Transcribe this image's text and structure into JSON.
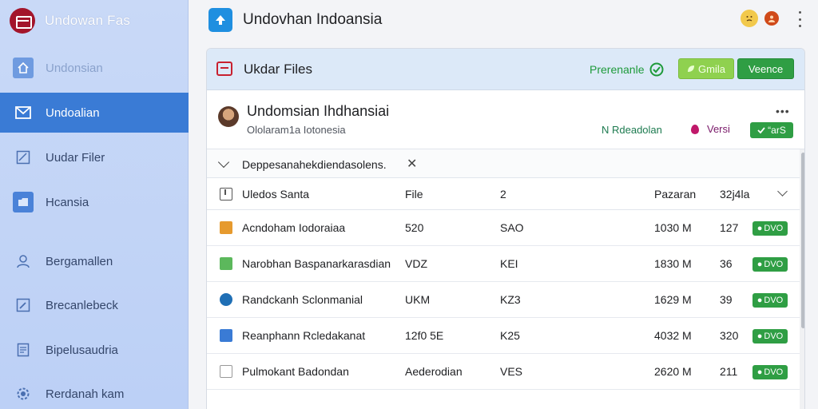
{
  "colors": {
    "sidebar_bg": "#c9d9f7",
    "active_nav": "#3a7bd5",
    "brand_red": "#a3152b",
    "accent_green": "#2f9e44",
    "lime": "#8fd14f",
    "header_blue": "#dce9f8"
  },
  "sidebar": {
    "brand_title": "Undowan Fas",
    "items": [
      {
        "label": "Undonsian",
        "icon": "home-icon"
      },
      {
        "label": "Undoalian",
        "icon": "mail-icon"
      },
      {
        "label": "Uudar Filer",
        "icon": "file-icon"
      },
      {
        "label": "Hcansia",
        "icon": "folder-icon"
      },
      {
        "label": "Bergamallen",
        "icon": "user-icon"
      },
      {
        "label": "Brecanlebeck",
        "icon": "edit-icon"
      },
      {
        "label": "Bipelusaudria",
        "icon": "document-icon"
      },
      {
        "label": "Rerdanah kam",
        "icon": "settings-icon"
      }
    ]
  },
  "topbar": {
    "title": "Undovhan Indoansia",
    "logo_icon": "upload-icon",
    "emoji_icon": "emoji-icon",
    "account_icon": "account-icon",
    "menu_icon": "more-vertical-icon"
  },
  "panel": {
    "header": {
      "icon": "folder-red-icon",
      "title": "Ukdar Files",
      "link_label": "Prerenanle",
      "lime_button": "Gmila",
      "green_button": "Veence"
    },
    "profile": {
      "name": "Undomsian Ihdhansiai",
      "subtitle": "Ololaram1a Iotonesia",
      "more": "•••",
      "tag1": "N Rdeadolan",
      "tag2": "Versi",
      "badge": "“arS"
    },
    "filter": {
      "text": "Deppesanahekdiendasolens.",
      "clear": "✕"
    },
    "columns": [
      "Uledos Santa",
      "File",
      "2",
      "Pazaran",
      "32j4la"
    ],
    "rows": [
      {
        "name": "Acndoham Iodoraiaa",
        "file": "520",
        "col3": "SAO",
        "size": "1030 M",
        "count": "127",
        "badge": "DVO",
        "icon_color": "#e69a2e"
      },
      {
        "name": "Narobhan Baspanarkarasdian",
        "file": "VDZ",
        "col3": "KEI",
        "size": "1830 M",
        "count": "36",
        "badge": "DVO",
        "icon_color": "#5cb85c"
      },
      {
        "name": "Randckanh Sclonmanial",
        "file": "UKM",
        "col3": "KZ3",
        "size": "1629 M",
        "count": "39",
        "badge": "DVO",
        "icon_color": "#1f6fb5"
      },
      {
        "name": "Reanphann Rcledakanat",
        "file": "12f0 5E",
        "col3": "K25",
        "size": "4032 M",
        "count": "320",
        "badge": "DVO",
        "icon_color": "#3a7bd5"
      },
      {
        "name": "Pulmokant Badondan",
        "file": "Aederodian",
        "col3": "VES",
        "size": "2620 M",
        "count": "211",
        "badge": "DVO",
        "icon_color": "#ffffff"
      }
    ]
  }
}
